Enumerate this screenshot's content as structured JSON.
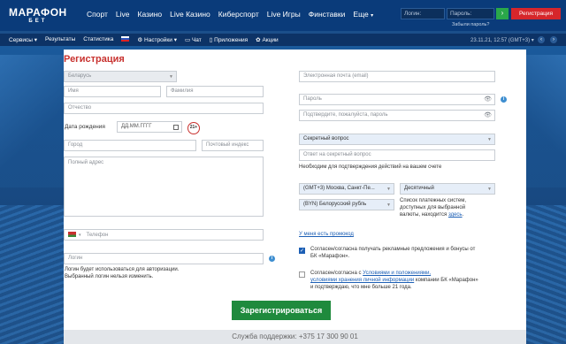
{
  "brand": {
    "line1": "МАРАФОН",
    "line2": "БЕТ"
  },
  "main_nav": [
    "Спорт",
    "Live",
    "Казино",
    "Live Казино",
    "Киберспорт",
    "Live Игры",
    "Финставки",
    "Еще"
  ],
  "auth": {
    "login_placeholder": "Логин:",
    "password_placeholder": "Пароль:",
    "go": "›",
    "register_button": "Регистрация",
    "forgot": "Забыли пароль?"
  },
  "sub_nav": [
    "Сервисы",
    "Результаты",
    "Статистика",
    "Настройки",
    "Чат",
    "Приложения",
    "Акции"
  ],
  "datetime": "23.11.21, 12:57 (GMT+3)",
  "form": {
    "title": "Регистрация",
    "country": "Беларусь",
    "name_ph": "Имя",
    "surname_ph": "Фамилия",
    "patronymic_ph": "Отчество",
    "dob_label": "Дата рождения",
    "dob_ph": "ДД.ММ.ГГГГ",
    "age_badge": "21+",
    "city_ph": "Город",
    "zip_ph": "Почтовый индекс",
    "address_ph": "Полный адрес",
    "phone_ph": "Телефон",
    "login_ph": "Логин",
    "login_hint1": "Логин будет использоваться для авторизации.",
    "login_hint2": "Выбранный логин нельзя изменить.",
    "email_ph": "Электронная почта (email)",
    "password_ph": "Пароль",
    "password_confirm_ph": "Подтвердите, пожалуйста, пароль",
    "secret_q": "Секретный вопрос",
    "secret_a_ph": "Ответ на секретный вопрос",
    "secret_note": "Необходим для подтверждения действий на вашем счете",
    "timezone": "(GMT+3) Москва, Санкт-Пе...",
    "odds_format": "Десятичный",
    "currency": "(BYN) Белорусский рубль",
    "payment_note1": "Список платежных систем,",
    "payment_note2": "доступных для выбранной",
    "payment_note3_a": "валюты, находится ",
    "payment_note3_link": "здесь",
    "promo_link": "У меня есть промокод",
    "consent_ads_1": "Согласен/согласна получать рекламные предложения и бонусы от",
    "consent_ads_2": "БК «Марафон».",
    "consent_terms_1a": "Согласен/согласна с ",
    "consent_terms_1link": "Условиями и положениями,",
    "consent_terms_2link": "условиями хранения личной информации",
    "consent_terms_2b": " компании БК «Марафон»",
    "consent_terms_3": "и подтверждаю, что мне больше 21 года.",
    "submit": "Зарегистрироваться"
  },
  "support": "Служба поддержки: +375 17 300 90 01"
}
